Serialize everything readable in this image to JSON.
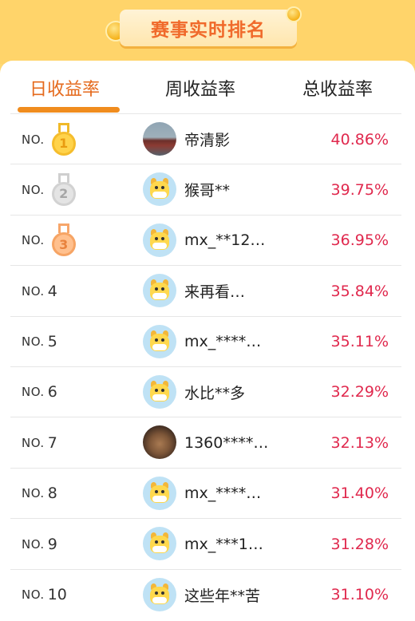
{
  "header": {
    "title": "赛事实时排名"
  },
  "tabs": [
    {
      "label": "日收益率",
      "active": true
    },
    {
      "label": "周收益率",
      "active": false
    },
    {
      "label": "总收益率",
      "active": false
    }
  ],
  "colors": {
    "accent": "#e56a1d",
    "rate": "#e0284d",
    "background": "#ffd873"
  },
  "rank_prefix": "NO.",
  "rows": [
    {
      "rank": "1",
      "medal": "gold-medal",
      "avatar": "photo-ship",
      "name": "帝清影",
      "rate": "40.86%"
    },
    {
      "rank": "2",
      "medal": "silver-medal",
      "avatar": "cow",
      "name": "猴哥**",
      "rate": "39.75%"
    },
    {
      "rank": "3",
      "medal": "bronze-medal",
      "avatar": "cow",
      "name": "mx_**12…",
      "rate": "36.95%"
    },
    {
      "rank": "4",
      "medal": "",
      "avatar": "cow",
      "name": "来再看…",
      "rate": "35.84%"
    },
    {
      "rank": "5",
      "medal": "",
      "avatar": "cow",
      "name": "mx_****…",
      "rate": "35.11%"
    },
    {
      "rank": "6",
      "medal": "",
      "avatar": "cow",
      "name": "水比**多",
      "rate": "32.29%"
    },
    {
      "rank": "7",
      "medal": "",
      "avatar": "photo-dog",
      "name": "1360****…",
      "rate": "32.13%"
    },
    {
      "rank": "8",
      "medal": "",
      "avatar": "cow",
      "name": "mx_****…",
      "rate": "31.40%"
    },
    {
      "rank": "9",
      "medal": "",
      "avatar": "cow",
      "name": "mx_***1…",
      "rate": "31.28%"
    },
    {
      "rank": "10",
      "medal": "",
      "avatar": "cow",
      "name": "这些年**苦",
      "rate": "31.10%"
    }
  ]
}
